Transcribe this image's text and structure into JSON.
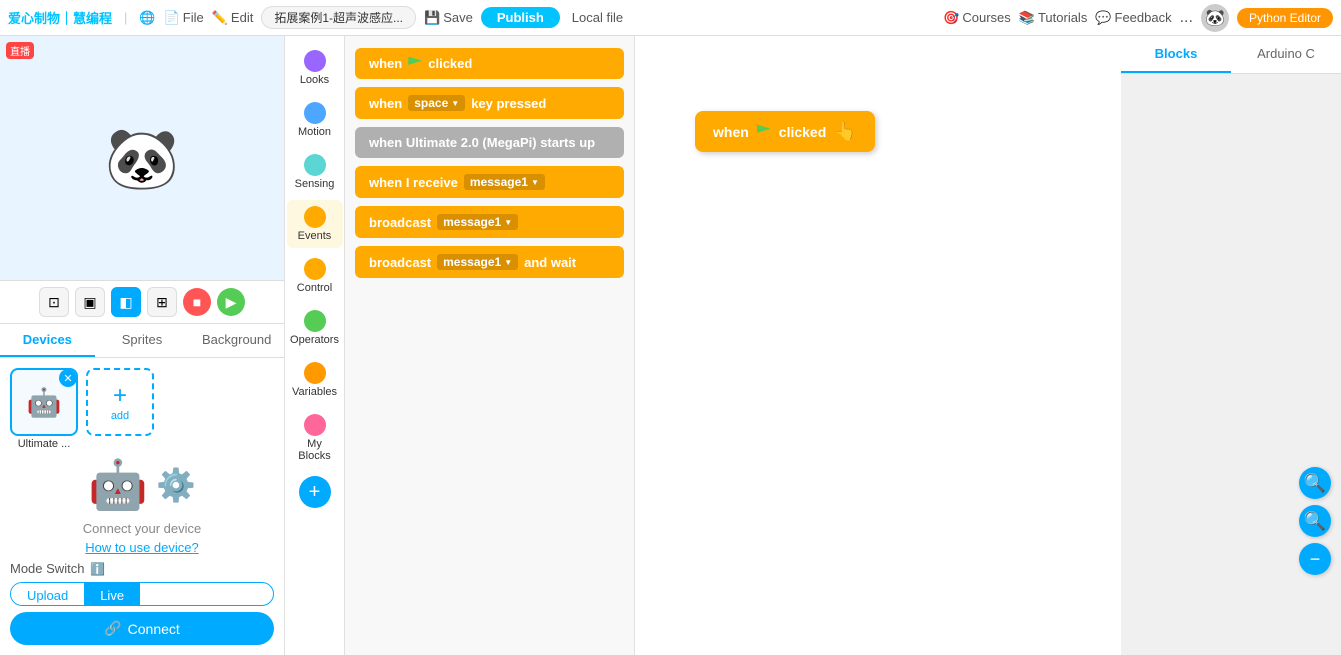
{
  "topbar": {
    "logo": "爱心制物｜慧编程",
    "globe_icon": "🌐",
    "file_label": "File",
    "edit_label": "Edit",
    "project_name": "拓展案例1-超声波感应...",
    "save_label": "Save",
    "publish_label": "Publish",
    "localfile_label": "Local file",
    "courses_label": "Courses",
    "tutorials_label": "Tutorials",
    "feedback_label": "Feedback",
    "more_label": "...",
    "python_editor_label": "Python Editor"
  },
  "toolbar": {
    "fit_label": "⊞",
    "single_label": "▣",
    "highlight_label": "◧",
    "grid_label": "⊞",
    "stop_label": "■",
    "play_label": "▶"
  },
  "tabs": {
    "devices": "Devices",
    "sprites": "Sprites",
    "background": "Background"
  },
  "device": {
    "connect_text": "Connect your device",
    "how_to_use": "How to use device?",
    "mode_switch": "Mode Switch",
    "upload_label": "Upload",
    "live_label": "Live",
    "connect_btn": "Connect",
    "sprite_name": "Ultimate ..."
  },
  "palette": {
    "items": [
      {
        "id": "looks",
        "label": "Looks",
        "color": "looks"
      },
      {
        "id": "motion",
        "label": "Motion",
        "color": "motion"
      },
      {
        "id": "sensing",
        "label": "Sensing",
        "color": "sensing"
      },
      {
        "id": "events",
        "label": "Events",
        "color": "events"
      },
      {
        "id": "control",
        "label": "Control",
        "color": "control"
      },
      {
        "id": "operators",
        "label": "Operators",
        "color": "operators"
      },
      {
        "id": "variables",
        "label": "Variables",
        "color": "variables"
      },
      {
        "id": "myblocks",
        "label": "My Blocks",
        "color": "myblocks"
      }
    ]
  },
  "blocks": {
    "when_clicked": "when",
    "when_clicked_text": "clicked",
    "when_key_pressed": "when",
    "key_space": "space",
    "key_pressed": "key pressed",
    "when_starts_up": "when Ultimate 2.0 (MegaPi) starts up",
    "when_receive": "when I receive",
    "message1": "message1",
    "broadcast": "broadcast",
    "broadcast_wait": "broadcast",
    "and_wait": "and wait"
  },
  "canvas": {
    "block_text": "when",
    "block_clicked": "clicked"
  },
  "right_tabs": {
    "blocks": "Blocks",
    "arduino": "Arduino C"
  },
  "zoom": {
    "in": "+",
    "out": "−",
    "minus": "−"
  }
}
